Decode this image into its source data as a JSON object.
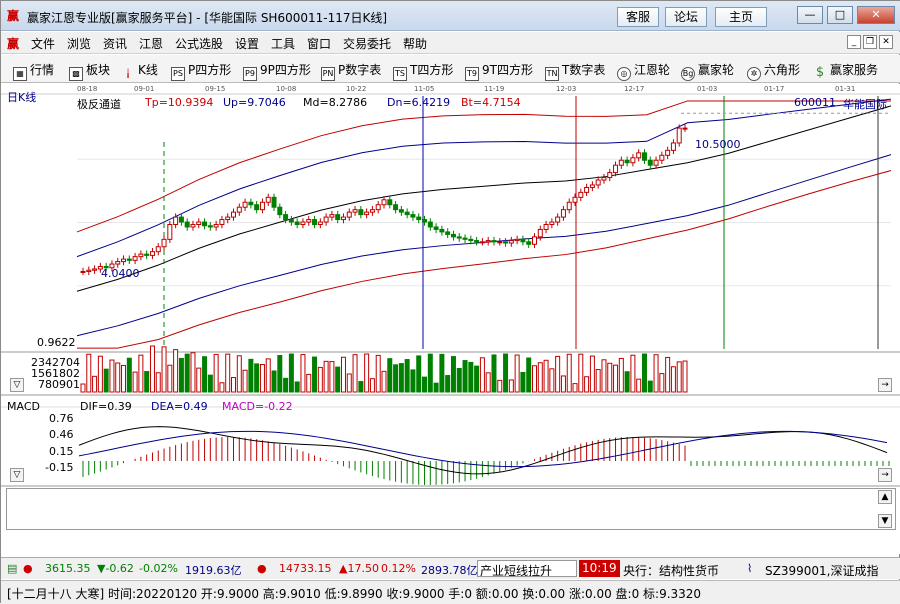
{
  "window": {
    "title": "赢家江恩专业版[赢家服务平台] - [华能国际  SH600011-117日K线]",
    "buttons": [
      "客服",
      "论坛",
      "主页"
    ]
  },
  "menu": [
    "文件",
    "浏览",
    "资讯",
    "江恩",
    "公式选股",
    "设置",
    "工具",
    "窗口",
    "交易委托",
    "帮助"
  ],
  "toolbar": [
    {
      "label": "行情",
      "icon": "grid-icon"
    },
    {
      "label": "板块",
      "icon": "blocks-icon"
    },
    {
      "label": "K线",
      "icon": "candle-icon"
    },
    {
      "label": "P四方形",
      "icon": "ps-icon",
      "glyph": "PS"
    },
    {
      "label": "9P四方形",
      "icon": "p9-icon",
      "glyph": "P9"
    },
    {
      "label": "P数字表",
      "icon": "pn-icon",
      "glyph": "PN"
    },
    {
      "label": "T四方形",
      "icon": "ts-icon",
      "glyph": "TS"
    },
    {
      "label": "9T四方形",
      "icon": "t9-icon",
      "glyph": "T9"
    },
    {
      "label": "T数字表",
      "icon": "tn-icon",
      "glyph": "TN"
    },
    {
      "label": "江恩轮",
      "icon": "wheel-icon",
      "glyph": "◎"
    },
    {
      "label": "赢家轮",
      "icon": "big-icon",
      "glyph": "Bg"
    },
    {
      "label": "六角形",
      "icon": "hexagon-icon",
      "glyph": "✲"
    },
    {
      "label": "赢家服务",
      "icon": "dollar-icon",
      "glyph": "$"
    }
  ],
  "chart": {
    "period_label": "日K线",
    "indicator_name": "极反通道",
    "tp": "Tp=10.9394",
    "up": "Up=9.7046",
    "md": "Md=8.2786",
    "dn": "Dn=6.4219",
    "bt": "Bt=4.7154",
    "stock_code": "600011",
    "stock_name": "华能国际",
    "dates": [
      "08-18",
      "09-01",
      "09-15",
      "10-08",
      "10-22",
      "11-05",
      "11-19",
      "12-03",
      "12-17",
      "01-03",
      "01-17",
      "01-31"
    ],
    "high_mark": "10.5000",
    "low_mark": "4.0400",
    "price_min_label": "0.9622",
    "volume_labels": [
      "2342704",
      "1561802",
      "780901"
    ],
    "macd_title": "MACD",
    "dif": "DIF=0.39",
    "dea": "DEA=0.49",
    "macd": "MACD=-0.22",
    "macd_ticks": [
      "0.76",
      "0.46",
      "0.15",
      "-0.15"
    ]
  },
  "chart_data": {
    "type": "candlestick",
    "closes": [
      4.1,
      4.15,
      4.2,
      4.3,
      4.25,
      4.4,
      4.5,
      4.6,
      4.55,
      4.7,
      4.8,
      4.75,
      4.9,
      5.1,
      5.4,
      6.0,
      6.3,
      6.1,
      5.9,
      6.0,
      6.1,
      5.95,
      5.9,
      6.0,
      6.2,
      6.3,
      6.5,
      6.7,
      6.9,
      6.8,
      6.6,
      6.9,
      7.1,
      6.7,
      6.4,
      6.2,
      6.1,
      6.0,
      6.1,
      6.2,
      6.0,
      6.1,
      6.3,
      6.4,
      6.2,
      6.3,
      6.5,
      6.6,
      6.4,
      6.5,
      6.6,
      6.8,
      7.0,
      6.8,
      6.6,
      6.5,
      6.4,
      6.3,
      6.2,
      6.1,
      5.9,
      5.8,
      5.7,
      5.6,
      5.5,
      5.45,
      5.4,
      5.35,
      5.3,
      5.3,
      5.35,
      5.3,
      5.3,
      5.25,
      5.35,
      5.4,
      5.3,
      5.2,
      5.5,
      5.8,
      6.0,
      6.1,
      6.3,
      6.6,
      6.9,
      7.1,
      7.3,
      7.5,
      7.6,
      7.8,
      7.9,
      8.1,
      8.4,
      8.6,
      8.5,
      8.7,
      8.9,
      8.6,
      8.4,
      8.6,
      8.8,
      9.0,
      9.3,
      9.9,
      9.9
    ]
  },
  "ticker": {
    "sh_index": "3615.35",
    "sh_change": "▼-0.62",
    "sh_pct": "-0.02%",
    "sh_amount": "1919.63亿",
    "sz_index": "14733.15",
    "sz_change": "▲17.50",
    "sz_pct": "0.12%",
    "sz_amount": "2893.78亿",
    "news": "产业短线拉升",
    "time": "10:19",
    "news2": "央行：结构性货币",
    "code": "SZ399001,深证成指"
  },
  "statusbar": "[十二月十八 大寒] 时间:20220120 开:9.9000 高:9.9010 低:9.8990 收:9.9000 手:0 额:0.00 换:0.00 涨:0.00 盘:0 标:9.3320"
}
